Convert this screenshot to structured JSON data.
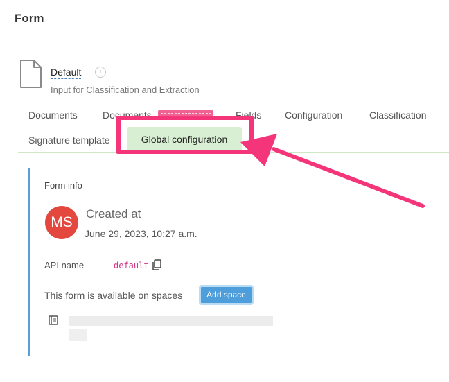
{
  "header": {
    "title": "Form"
  },
  "form": {
    "name": "Default",
    "description": "Input for Classification and Extraction"
  },
  "tabs": {
    "row1": [
      "Documents",
      "Documents",
      "Fields",
      "Configuration",
      "Classification"
    ],
    "row2": [
      "Signature template",
      "Global configuration"
    ],
    "active": "Global configuration"
  },
  "form_info": {
    "title": "Form info",
    "avatar_initials": "MS",
    "created_label": "Created at",
    "created_date": "June 29, 2023, 10:27 a.m.",
    "api_name_label": "API name",
    "api_name_value": "default",
    "spaces_text": "This form is available on spaces",
    "add_space_label": "Add space"
  },
  "colors": {
    "avatar": "#e4473d",
    "active_tab": "#d9efd3",
    "annotation": "#f5357a",
    "add_space_button": "#4e9edb",
    "api_value": "#d63384"
  },
  "icons": [
    "document-icon",
    "info-icon",
    "copy-icon",
    "book-icon"
  ]
}
